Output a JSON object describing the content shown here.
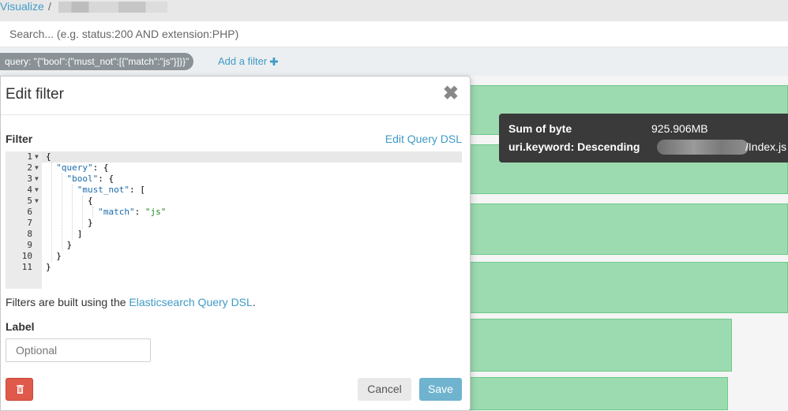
{
  "breadcrumb": {
    "link": "Visualize",
    "separator": "/"
  },
  "search": {
    "value": "",
    "placeholder": "Search... (e.g. status:200 AND extension:PHP)"
  },
  "filterbar": {
    "pill": "query: \"{\"bool\":{\"must_not\":[{\"match\":\"js\"}]}}\"",
    "add_filter": "Add a filter",
    "add_icon": "plus-icon"
  },
  "tooltip": {
    "metric_label": "Sum of byte",
    "metric_value": "925.906MB",
    "term_label": "uri.keyword: Descending",
    "term_value_suffix": "/Index.js"
  },
  "chart": {
    "bar_color": "#9cdbb0",
    "bar_values_relative": [
      1.0,
      1.0,
      1.0,
      1.0,
      0.928,
      0.923
    ]
  },
  "modal": {
    "title": "Edit filter",
    "close_icon": "close-icon",
    "filter_label": "Filter",
    "edit_dsl_link": "Edit Query DSL",
    "code": {
      "lines": [
        {
          "n": "1",
          "fold": true
        },
        {
          "n": "2",
          "fold": true
        },
        {
          "n": "3",
          "fold": true
        },
        {
          "n": "4",
          "fold": true
        },
        {
          "n": "5",
          "fold": true
        },
        {
          "n": "6",
          "fold": false
        },
        {
          "n": "7",
          "fold": false
        },
        {
          "n": "8",
          "fold": false
        },
        {
          "n": "9",
          "fold": false
        },
        {
          "n": "10",
          "fold": false
        },
        {
          "n": "11",
          "fold": false
        }
      ],
      "text": {
        "l1": "{",
        "l2_key": "\"query\"",
        "l2_rest": ": {",
        "l3_key": "\"bool\"",
        "l3_rest": ": {",
        "l4_key": "\"must_not\"",
        "l4_rest": ": [",
        "l5": "{",
        "l6_key": "\"match\"",
        "l6_sep": ": ",
        "l6_val": "\"js\"",
        "l7": "}",
        "l8": "]",
        "l9": "}",
        "l10": "}",
        "l11": "}"
      }
    },
    "help_prefix": "Filters are built using the ",
    "help_link": "Elasticsearch Query DSL",
    "help_suffix": ".",
    "label_heading": "Label",
    "label_input": {
      "value": "",
      "placeholder": "Optional"
    },
    "delete_icon": "trash-icon",
    "cancel": "Cancel",
    "save": "Save"
  }
}
